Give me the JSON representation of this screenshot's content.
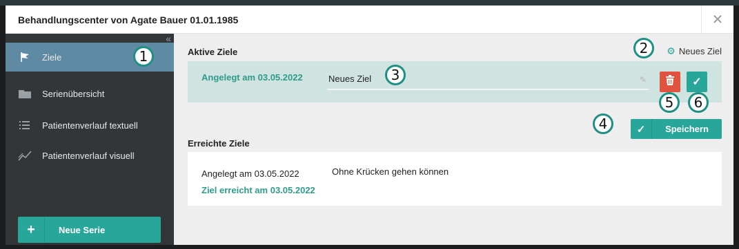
{
  "modal": {
    "title": "Behandlungscenter von Agate Bauer 01.01.1985",
    "close": "✕"
  },
  "sidebar": {
    "collapse": "«",
    "items": [
      {
        "label": "Ziele",
        "icon": "flag-icon"
      },
      {
        "label": "Serienübersicht",
        "icon": "folder-icon"
      },
      {
        "label": "Patientenverlauf textuell",
        "icon": "list-icon"
      },
      {
        "label": "Patientenverlauf visuell",
        "icon": "chart-icon"
      }
    ],
    "new_serie": {
      "plus": "+",
      "label": "Neue Serie"
    }
  },
  "main": {
    "active_title": "Aktive Ziele",
    "new_goal": {
      "icon": "⚙",
      "label": "Neues Ziel"
    },
    "active_goal": {
      "created": "Angelegt am 03.05.2022",
      "value": "Neues Ziel",
      "pencil": "✎",
      "ok": "✓"
    },
    "save": {
      "icon": "✓",
      "label": "Speichern"
    },
    "reached_title": "Erreichte Ziele",
    "reached_goal": {
      "created": "Angelegt am 03.05.2022",
      "done": "Ziel erreicht am 03.05.2022",
      "text": "Ohne Krücken gehen können"
    }
  },
  "callouts": [
    "1",
    "2",
    "3",
    "4",
    "5",
    "6"
  ],
  "colors": {
    "accent": "#29a69a",
    "danger": "#e0533e",
    "sidebar": "#333639",
    "active": "#5f8aa4"
  }
}
